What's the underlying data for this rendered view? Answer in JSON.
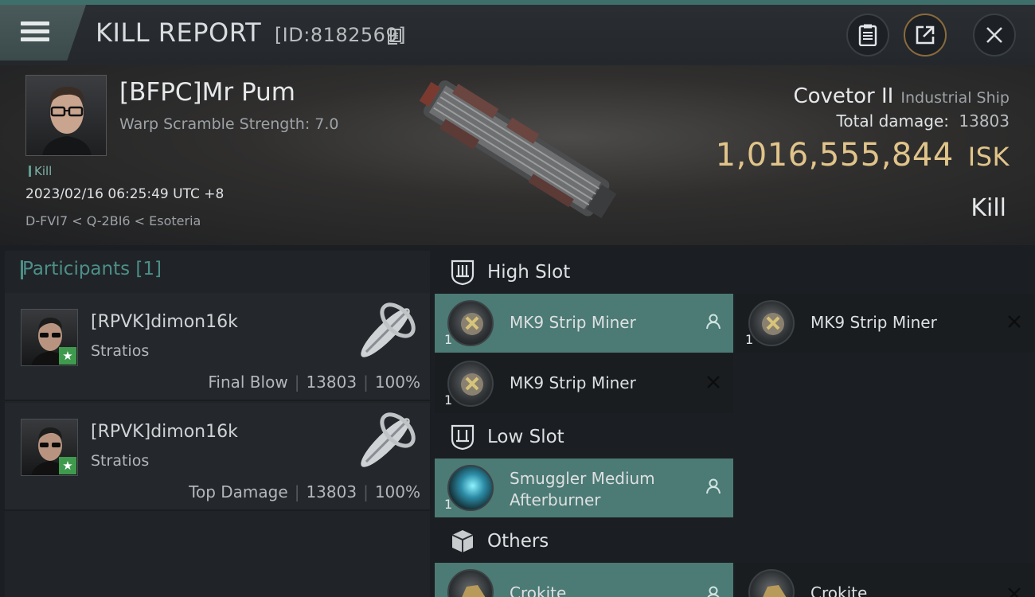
{
  "header": {
    "title": "KILL REPORT",
    "report_id": "[ID:8182569]"
  },
  "victim": {
    "name": "[BFPC]Mr Pum",
    "warp_scramble": "Warp Scramble Strength: 7.0",
    "tag": "Kill",
    "datetime": "2023/02/16 06:25:49 UTC +8",
    "location": "D-FVI7 < Q-2BI6 < Esoteria",
    "ship_name": "Covetor II",
    "ship_class": "Industrial Ship",
    "total_damage_label": "Total damage:",
    "total_damage": "13803",
    "isk_value": "1,016,555,844",
    "isk_unit": "ISK",
    "result": "Kill"
  },
  "participants": {
    "title": "Participants [1]",
    "rows": [
      {
        "name": "[RPVK]dimon16k",
        "ship": "Stratios",
        "role": "Final Blow",
        "damage": "13803",
        "percent": "100%"
      },
      {
        "name": "[RPVK]dimon16k",
        "ship": "Stratios",
        "role": "Top Damage",
        "damage": "13803",
        "percent": "100%"
      }
    ]
  },
  "slots": {
    "high": {
      "label": "High Slot",
      "items": [
        {
          "name": "MK9 Strip Miner",
          "qty": "1",
          "state": "dropped"
        },
        {
          "name": "MK9 Strip Miner",
          "qty": "1",
          "state": "destroyed"
        },
        {
          "name": "MK9 Strip Miner",
          "qty": "1",
          "state": "destroyed"
        }
      ]
    },
    "low": {
      "label": "Low Slot",
      "items": [
        {
          "name_line1": "Smuggler Medium",
          "name_line2": "Afterburner",
          "qty": "1",
          "state": "dropped"
        }
      ]
    },
    "others": {
      "label": "Others",
      "items": [
        {
          "name": "Crokite",
          "qty": "",
          "state": "dropped"
        },
        {
          "name": "Crokite",
          "qty": "",
          "state": "destroyed"
        }
      ]
    }
  },
  "colors": {
    "accent_teal": "#4d8f88",
    "dropped_bg": "#4c7a74",
    "isk_gold": "#e1c48a"
  }
}
